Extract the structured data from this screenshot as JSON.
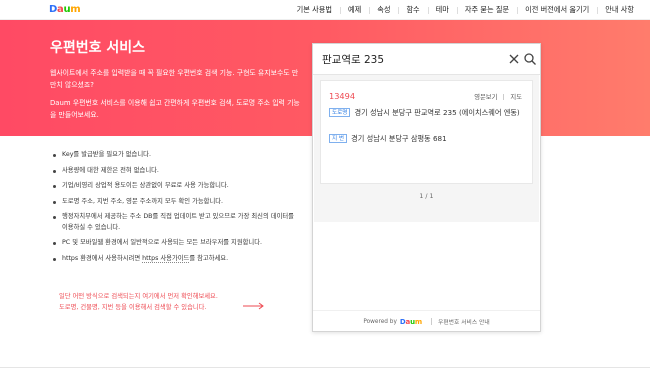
{
  "nav": {
    "logo": [
      "D",
      "a",
      "u",
      "m"
    ],
    "items": [
      "기본 사용법",
      "예제",
      "속성",
      "함수",
      "테마",
      "자주 묻는 질문",
      "이전 버전에서 옮기기",
      "안내 사항"
    ]
  },
  "hero": {
    "title": "우편번호 서비스",
    "desc1": "웹사이트에서 주소를 입력받을 때 꼭 필요한 우편번호 검색 기능. 구현도 유지보수도 만만치 않으셨죠?",
    "desc2": "Daum 우편번호 서비스를 이용해 쉽고 간편하게 우편번호 검색, 도로명 주소 입력 기능을 만들어보세요."
  },
  "features": [
    "Key를 발급받을 필요가 없습니다.",
    "사용량에 대한 제한은 전혀 없습니다.",
    "기업/비영리 상업적 용도이든 상관없이 무료로 사용 가능합니다.",
    "도로명 주소, 지번 주소, 영문 주소까지 모두 확인 가능합니다.",
    "행정자치부에서 제공하는 주소 DB를 직접 업데이트 받고 있으므로 가장 최신의 데이터를 이용하실 수 있습니다.",
    "PC 및 모바일웹 환경에서 일반적으로 사용되는 모든 브라우저를 지원합니다."
  ],
  "https_note": {
    "prefix": "https 환경에서 사용하시려면 ",
    "link": "https 사용가이드",
    "suffix": "를 참고하세요."
  },
  "notice": {
    "line1": "일단 어떤 방식으로 검색되는지 여기에서 먼저 확인해보세요.",
    "line2": "도로명, 건물명, 지번 등을 이용해서 검색할 수 있습니다."
  },
  "search": {
    "value": "판교역로 235",
    "results": [
      {
        "zipcode": "13494",
        "links": [
          "영문보기",
          "지도"
        ],
        "road_tag": "도로명",
        "road_address": "경기 성남시 분당구 판교역로 235 (에이치스퀘어 엔동)",
        "jibun_tag": "지 번",
        "jibun_address": "경기 성남시 분당구 삼평동 681"
      }
    ],
    "pagination": "1 / 1"
  },
  "panel_footer": {
    "powered": "Powered by",
    "logo": [
      "D",
      "a",
      "u",
      "m"
    ],
    "guide": "우편번호 서비스 안내"
  },
  "colors": {
    "hero_start": "#ff4a64",
    "hero_end": "#ff7c6c",
    "accent_red": "#ee4a52",
    "tag_blue": "#2a7be4"
  }
}
